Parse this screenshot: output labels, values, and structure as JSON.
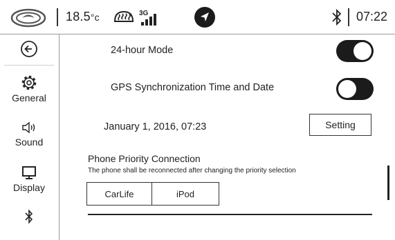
{
  "status_bar": {
    "temperature_value": "18.5",
    "temperature_unit": "°c",
    "time": "07:22",
    "icons": [
      "brand-logo",
      "rear-defrost-icon",
      "signal-icon",
      "navigation-icon",
      "bluetooth-icon"
    ]
  },
  "sidebar": {
    "items": [
      {
        "label": "",
        "icon": "back-icon"
      },
      {
        "label": "General",
        "icon": "gear-icon"
      },
      {
        "label": "Sound",
        "icon": "speaker-icon"
      },
      {
        "label": "Display",
        "icon": "monitor-icon"
      },
      {
        "label": "",
        "icon": "bluetooth-icon"
      }
    ]
  },
  "settings": {
    "hour_mode": {
      "label": "24-hour Mode",
      "state": "on"
    },
    "gps_sync": {
      "label": "GPS Synchronization Time and Date",
      "state": "off"
    },
    "date_time": "January 1, 2016, 07:23",
    "setting_button": "Setting"
  },
  "phone_priority": {
    "title": "Phone Priority Connection",
    "description": "The phone shall be reconnected after changing the priority selection",
    "options": [
      "CarLife",
      "iPod"
    ]
  },
  "colors": {
    "toggle": "#1b1b1b",
    "divider": "#9a9a9a",
    "text": "#222222"
  }
}
